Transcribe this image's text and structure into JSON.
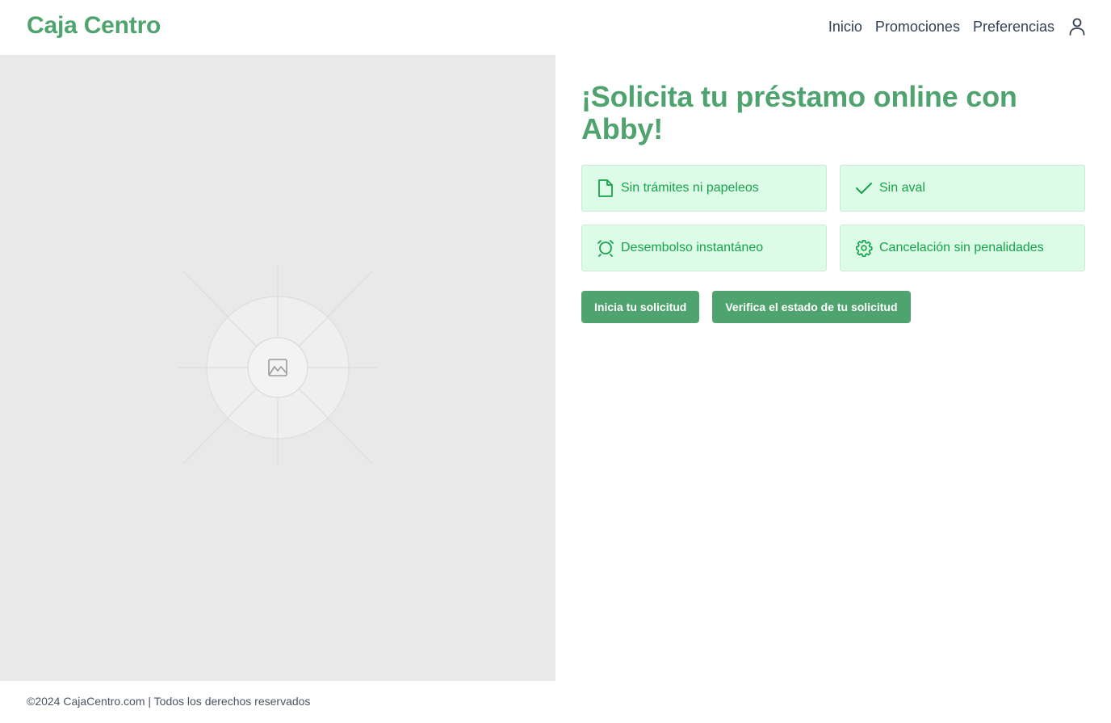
{
  "header": {
    "logo": "Caja Centro",
    "nav": [
      {
        "label": "Inicio"
      },
      {
        "label": "Promociones"
      },
      {
        "label": "Preferencias"
      }
    ],
    "user_icon": "user-icon"
  },
  "hero_image": {
    "icon": "image-placeholder-icon"
  },
  "main": {
    "title": "¡Solicita tu préstamo online con Abby!",
    "features": [
      {
        "label": "Sin trámites ni papeleos",
        "icon": "document-icon"
      },
      {
        "label": "Sin aval",
        "icon": "check-icon"
      },
      {
        "label": "Desembolso instantáneo",
        "icon": "alarm-clock-icon"
      },
      {
        "label": "Cancelación sin penalidades",
        "icon": "gear-icon"
      }
    ],
    "buttons": {
      "start": "Inicia tu solicitud",
      "verify": "Verifica el estado de tu solicitud"
    }
  },
  "footer": {
    "text": "©2024 CajaCentro.com | Todos los derechos reservados"
  },
  "colors": {
    "brand": "#4fa36f",
    "feature_bg": "#dcfce7",
    "feature_text": "#16a34a",
    "image_bg": "#e9e9e9"
  }
}
